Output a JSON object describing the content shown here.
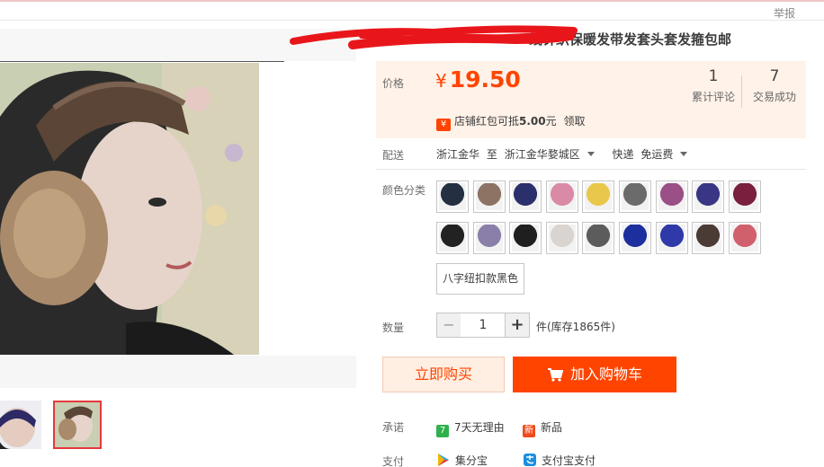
{
  "header": {
    "report_label": "举报"
  },
  "product": {
    "title": "线针织保暖发带发套头套发箍包邮"
  },
  "price": {
    "label": "价格",
    "currency": "¥",
    "value": "19.50",
    "reviews_count": "1",
    "reviews_label": "累计评论",
    "sales_count": "7",
    "sales_label": "交易成功",
    "promo_icon": "¥",
    "promo_prefix": "店铺红包可抵",
    "promo_amount": "5.00",
    "promo_unit": "元",
    "promo_action": "领取"
  },
  "shipping": {
    "label": "配送",
    "from": "浙江金华",
    "to_word": "至",
    "to": "浙江金华婺城区",
    "method": "快递",
    "fee": "免运费"
  },
  "sku": {
    "label": "颜色分类",
    "swatch_colors": [
      "#243042",
      "#8c7364",
      "#2b2f6b",
      "#d98aa6",
      "#e8c74a",
      "#6b6b6b",
      "#9a4f86",
      "#3a3686",
      "#7a1f3d",
      "#222222",
      "#8a7fa8",
      "#1f1f1f",
      "#d9d4cf",
      "#5c5c5c",
      "#1d2f9e",
      "#2f3aa8",
      "#4a3b35",
      "#d0606c"
    ],
    "text_option": "八字纽扣款黑色"
  },
  "quantity": {
    "label": "数量",
    "minus": "−",
    "plus": "+",
    "value": "1",
    "stock_text": "件(库存1865件)"
  },
  "actions": {
    "buy_now": "立即购买",
    "add_to_cart": "加入购物车"
  },
  "promise": {
    "label": "承诺",
    "items": [
      {
        "badge": "7",
        "text": "7天无理由",
        "color": "#2fb14b"
      },
      {
        "badge": "新",
        "text": "新品",
        "color": "#f04a1b"
      }
    ]
  },
  "payment": {
    "label": "支付",
    "items": [
      {
        "icon": "jifenbao-icon",
        "text": "集分宝"
      },
      {
        "icon": "alipay-icon",
        "text": "支付宝支付"
      }
    ]
  }
}
